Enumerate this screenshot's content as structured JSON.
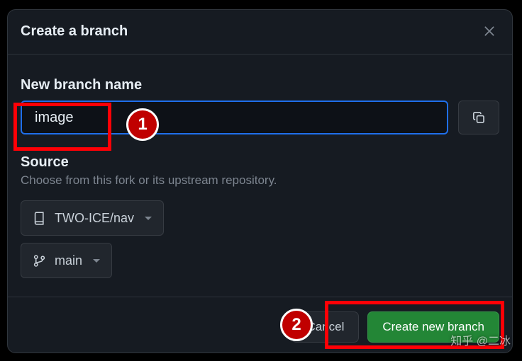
{
  "dialog": {
    "title": "Create a branch",
    "field_label": "New branch name",
    "input_value": "image",
    "source_label": "Source",
    "source_help": "Choose from this fork or its upstream repository.",
    "repo_selector": "TWO-ICE/nav",
    "branch_selector": "main",
    "cancel_label": "Cancel",
    "submit_label": "Create new branch"
  },
  "annotations": {
    "badge1": "1",
    "badge2": "2"
  },
  "watermark": "知乎 @二冰"
}
